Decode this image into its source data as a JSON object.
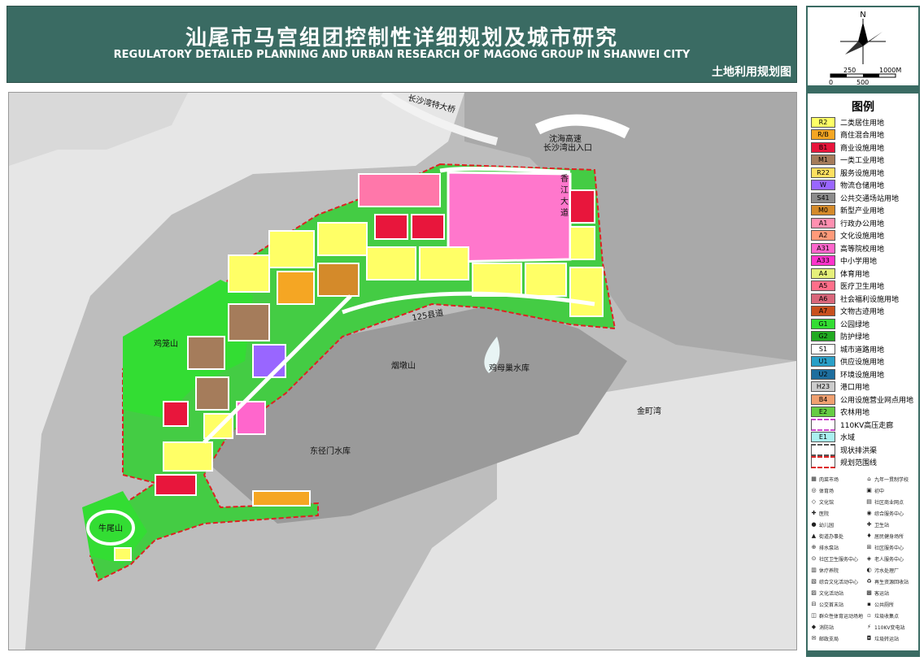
{
  "header": {
    "title_cn": "汕尾市马宫组团控制性详细规划及城市研究",
    "title_en": "REGULATORY DETAILED PLANNING AND URBAN RESEARCH OF MAGONG GROUP IN SHANWEI CITY",
    "subtitle": "土地利用规划图"
  },
  "compass": {
    "north": "N",
    "scale_top": [
      "250",
      "1000M"
    ],
    "scale_bottom": [
      "0",
      "500"
    ]
  },
  "map_labels": {
    "bridge": "长沙湾特大桥",
    "expressway": "沈海高速",
    "exit": "长沙湾出入口",
    "avenue": "香江大道",
    "county_road": "125县道",
    "mountain_jilong": "鸡笼山",
    "mountain_yandun": "烟墩山",
    "reservoir_jimu": "鸡母巢水库",
    "bay_jinding": "金町湾",
    "reservoir_dongjing": "东径门水库",
    "mountain_niuwei": "牛尾山"
  },
  "legend": {
    "title": "图例",
    "items": [
      {
        "code": "R2",
        "label": "二类居住用地",
        "color": "#ffff66"
      },
      {
        "code": "R/B",
        "label": "商住混合用地",
        "color": "#f5a623"
      },
      {
        "code": "B1",
        "label": "商业设施用地",
        "color": "#e8163c"
      },
      {
        "code": "M1",
        "label": "一类工业用地",
        "color": "#a57c5b"
      },
      {
        "code": "R22",
        "label": "服务设施用地",
        "color": "#ffe060"
      },
      {
        "code": "W",
        "label": "物流仓储用地",
        "color": "#9966ff"
      },
      {
        "code": "S41",
        "label": "公共交通场站用地",
        "color": "#8c8c8c"
      },
      {
        "code": "M0",
        "label": "新型产业用地",
        "color": "#d48a2a"
      },
      {
        "code": "A1",
        "label": "行政办公用地",
        "color": "#ff8fb0"
      },
      {
        "code": "A2",
        "label": "文化设施用地",
        "color": "#ff9a7a"
      },
      {
        "code": "A31",
        "label": "高等院校用地",
        "color": "#ff66cc"
      },
      {
        "code": "A33",
        "label": "中小学用地",
        "color": "#ff33cc"
      },
      {
        "code": "A4",
        "label": "体育用地",
        "color": "#e6f07a"
      },
      {
        "code": "A5",
        "label": "医疗卫生用地",
        "color": "#ff6f8a"
      },
      {
        "code": "A6",
        "label": "社会福利设施用地",
        "color": "#d9667a"
      },
      {
        "code": "A7",
        "label": "文物古迹用地",
        "color": "#c8501e"
      },
      {
        "code": "G1",
        "label": "公园绿地",
        "color": "#33dd33"
      },
      {
        "code": "G2",
        "label": "防护绿地",
        "color": "#22aa22"
      },
      {
        "code": "S1",
        "label": "城市道路用地",
        "color": "#ffffff"
      },
      {
        "code": "U1",
        "label": "供应设施用地",
        "color": "#2aa0c8"
      },
      {
        "code": "U2",
        "label": "环境设施用地",
        "color": "#1e6e9e"
      },
      {
        "code": "H23",
        "label": "港口用地",
        "color": "#cccccc"
      },
      {
        "code": "B4",
        "label": "公用设施营业网点用地",
        "color": "#f0a070"
      },
      {
        "code": "E2",
        "label": "农林用地",
        "color": "#66cc44"
      },
      {
        "code": "",
        "label": "110KV高压走廊",
        "color": "#cc44cc"
      },
      {
        "code": "E1",
        "label": "水域",
        "color": "#aaf0f0"
      },
      {
        "code": "",
        "label": "现状排洪渠",
        "color": "#555555"
      },
      {
        "code": "",
        "label": "规划范围线",
        "color": "#dd2222"
      }
    ],
    "icons": [
      {
        "icon": "market-icon",
        "label": "肉菜市场"
      },
      {
        "icon": "school-icon",
        "label": "九年一贯制学校"
      },
      {
        "icon": "stadium-icon",
        "label": "体育场"
      },
      {
        "icon": "middle-school-icon",
        "label": "初中"
      },
      {
        "icon": "culture-hall-icon",
        "label": "文化馆"
      },
      {
        "icon": "commercial-icon",
        "label": "社区商业网点"
      },
      {
        "icon": "hospital-icon",
        "label": "医院"
      },
      {
        "icon": "service-center-icon",
        "label": "综合服务中心"
      },
      {
        "icon": "kindergarten-icon",
        "label": "幼儿园"
      },
      {
        "icon": "health-station-icon",
        "label": "卫生站"
      },
      {
        "icon": "office-icon",
        "label": "街道办事处"
      },
      {
        "icon": "fitness-icon",
        "label": "居民健身场所"
      },
      {
        "icon": "drainage-icon",
        "label": "排水泵站"
      },
      {
        "icon": "community-service-icon",
        "label": "社区服务中心"
      },
      {
        "icon": "community-health-icon",
        "label": "社区卫生服务中心"
      },
      {
        "icon": "elderly-icon",
        "label": "老人服务中心"
      },
      {
        "icon": "nursing-icon",
        "label": "休疗养院"
      },
      {
        "icon": "sewage-icon",
        "label": "污水处理厂"
      },
      {
        "icon": "activity-center-icon",
        "label": "综合文化活动中心"
      },
      {
        "icon": "recycle-icon",
        "label": "再生资源回收站"
      },
      {
        "icon": "cultural-station-icon",
        "label": "文化活动站"
      },
      {
        "icon": "bus-station-icon",
        "label": "客运站"
      },
      {
        "icon": "bus-terminal-icon",
        "label": "公交首末站"
      },
      {
        "icon": "toilet-icon",
        "label": "公共厕所"
      },
      {
        "icon": "sports-ground-icon",
        "label": "群众性体育运动场地"
      },
      {
        "icon": "garbage-point-icon",
        "label": "垃圾收集点"
      },
      {
        "icon": "fire-station-icon",
        "label": "消防站"
      },
      {
        "icon": "substation-icon",
        "label": "110KV变电站"
      },
      {
        "icon": "post-icon",
        "label": "邮政支局"
      },
      {
        "icon": "transfer-icon",
        "label": "垃圾转运站"
      }
    ]
  }
}
